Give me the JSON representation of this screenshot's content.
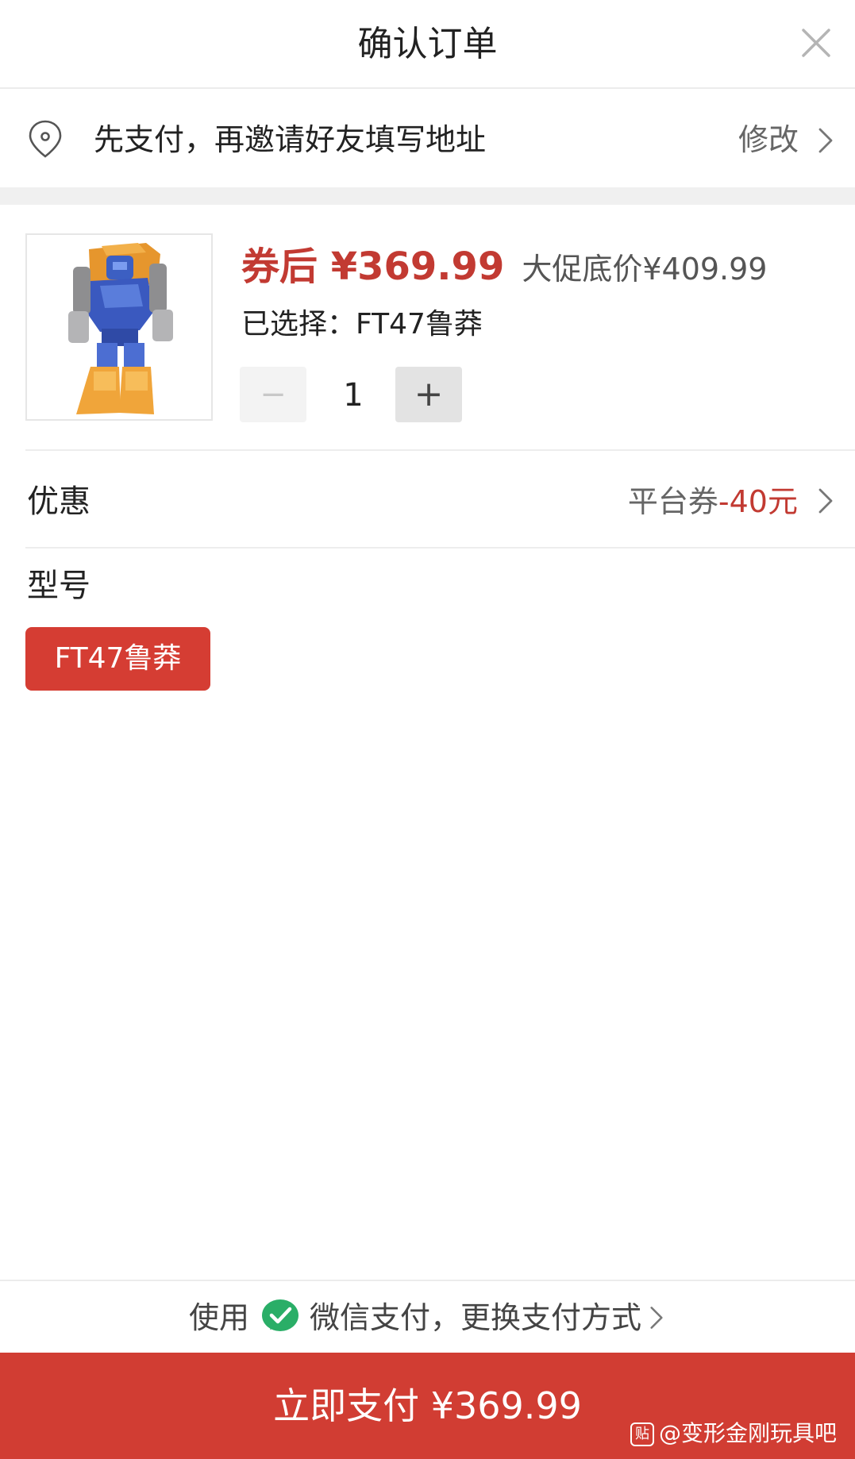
{
  "header": {
    "title": "确认订单",
    "close_icon": "close-icon"
  },
  "address": {
    "icon": "location-pin-icon",
    "text": "先支付，再邀请好友填写地址",
    "edit_label": "修改"
  },
  "product": {
    "image_icon": "robot-toy-image",
    "price_after_coupon": "券后 ¥369.99",
    "promo_price": "大促底价¥409.99",
    "selected": "已选择：FT47鲁莽",
    "quantity_minus": "−",
    "quantity": "1",
    "quantity_plus": "+"
  },
  "discount": {
    "label": "优惠",
    "type": "平台券",
    "amount": "-40元"
  },
  "model": {
    "label": "型号",
    "options": [
      "FT47鲁莽"
    ]
  },
  "payment": {
    "prefix": "使用",
    "icon": "wechat-pay-icon",
    "method_text": "微信支付，更换支付方式"
  },
  "pay_button": {
    "label": "立即支付 ¥369.99"
  },
  "watermark": {
    "badge": "贴",
    "text": "@变形金刚玩具吧"
  },
  "colors": {
    "accent_red": "#d13d33",
    "price_red": "#c23a32",
    "wechat_green": "#2aae67"
  }
}
